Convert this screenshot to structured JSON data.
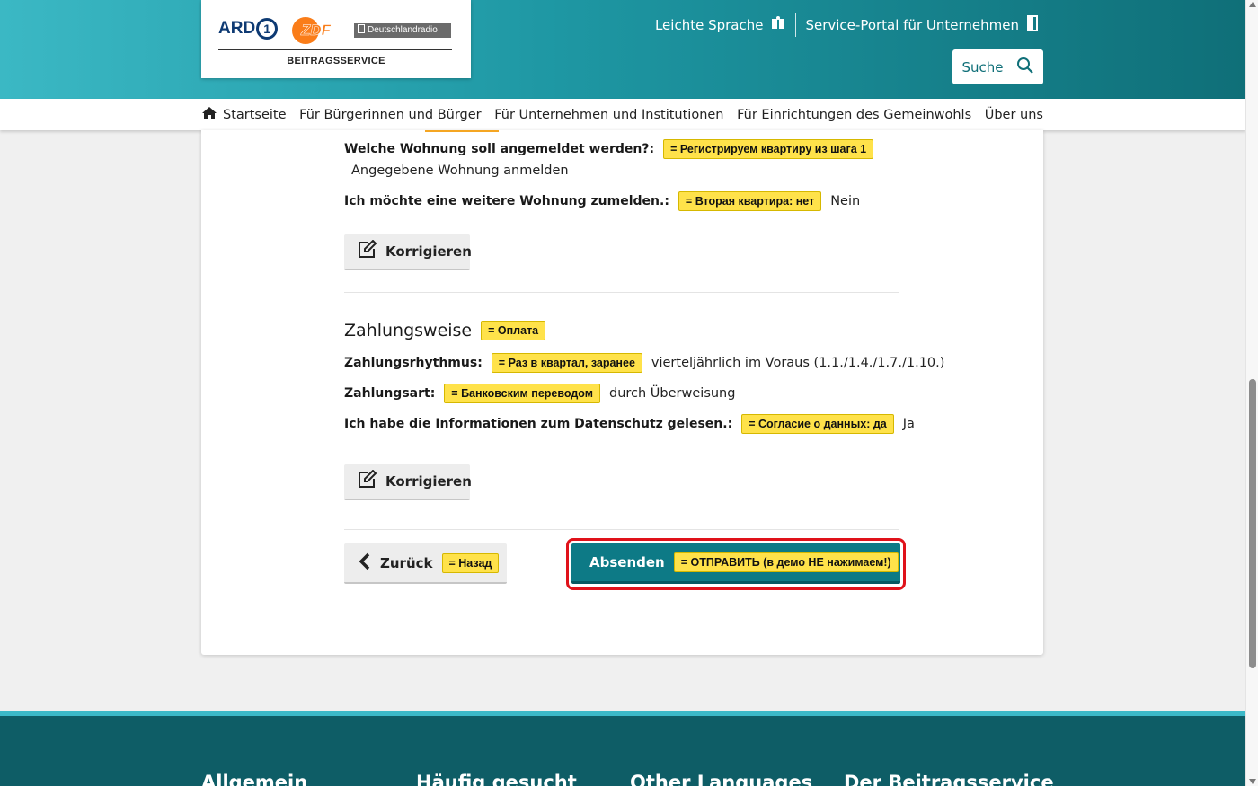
{
  "header": {
    "logo": {
      "ard": "ARD",
      "ard_number": "1",
      "zdf": "ZDF",
      "dlr": "Deutschlandradio",
      "beitragsservice": "BEITRAGSSERVICE"
    },
    "links": [
      {
        "label": "Leichte Sprache",
        "icon": "easy-language-icon"
      },
      {
        "label": "Service-Portal für Unternehmen",
        "icon": "exit-door-icon"
      }
    ],
    "search_label": "Suche"
  },
  "nav": {
    "items": [
      {
        "label": "Startseite",
        "icon": "home-icon"
      },
      {
        "label": "Für Bürgerinnen und Bürger"
      },
      {
        "label": "Für Unternehmen und Institutionen"
      },
      {
        "label": "Für Einrichtungen des Gemeinwohls"
      },
      {
        "label": "Über uns"
      }
    ]
  },
  "apartment": {
    "which_label": "Welche Wohnung soll angemeldet werden?:",
    "which_tag": "= Регистрируем квартиру из шага 1",
    "which_value": "Angegebene Wohnung anmelden",
    "another_label": "Ich möchte eine weitere Wohnung zumelden.:",
    "another_tag": "= Вторая квартира: нет",
    "another_value": "Nein",
    "correct_label": "Korrigieren"
  },
  "payment": {
    "title": "Zahlungsweise",
    "title_tag": "= Оплата",
    "rhythm_label": "Zahlungsrhythmus:",
    "rhythm_tag": "= Раз в квартал, заранее",
    "rhythm_value": "vierteljährlich im Voraus (1.1./1.4./1.7./1.10.)",
    "method_label": "Zahlungsart:",
    "method_tag": "= Банковским переводом",
    "method_value": "durch Überweisung",
    "privacy_label": "Ich habe die Informationen zum Datenschutz gelesen.:",
    "privacy_tag": "= Согласие о данных: да",
    "privacy_value": "Ja",
    "correct_label": "Korrigieren"
  },
  "actions": {
    "back_label": "Zurück",
    "back_tag": "= Назад",
    "submit_label": "Absenden",
    "submit_tag": "= ОТПРАВИТЬ (в демо НЕ нажимаем!)"
  },
  "footer": {
    "columns": [
      "Allgemein",
      "Häufig gesucht",
      "Other Languages",
      "Der Beitragsservice"
    ]
  },
  "colors": {
    "accent": "#0d7a86",
    "header_gradient_start": "#3bb8c4",
    "header_gradient_end": "#0f6f78",
    "annotation_tag": "#ffe24a",
    "highlight_ring": "#e0121a",
    "footer": "#0e5d66"
  }
}
